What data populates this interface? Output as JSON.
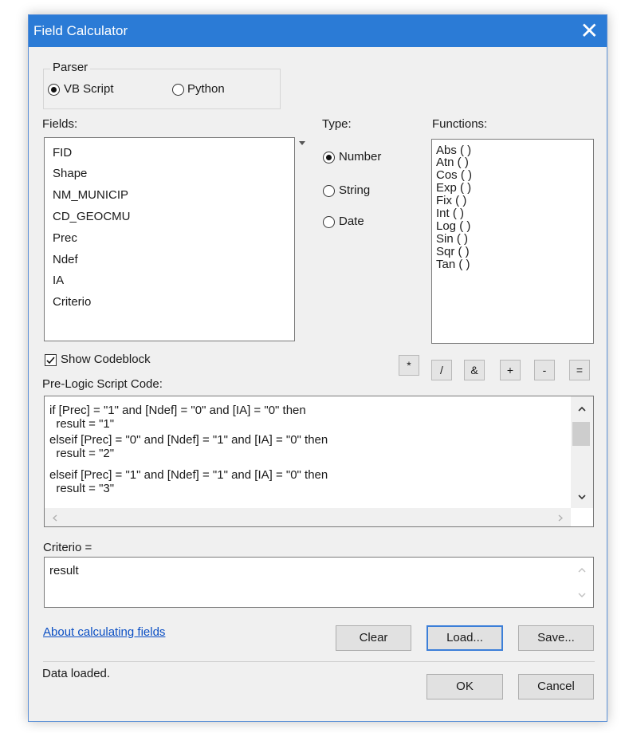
{
  "window": {
    "title": "Field Calculator",
    "close_glyph": "✕"
  },
  "parser": {
    "legend": "Parser",
    "options": [
      {
        "label": "VB Script",
        "selected": true
      },
      {
        "label": "Python",
        "selected": false
      }
    ]
  },
  "fields": {
    "label": "Fields:",
    "items": [
      "FID",
      "Shape",
      "NM_MUNICIP",
      "CD_GEOCMU",
      "Prec",
      "Ndef",
      "IA",
      "Criterio"
    ]
  },
  "type": {
    "label": "Type:",
    "options": [
      {
        "label": "Number",
        "selected": true
      },
      {
        "label": "String",
        "selected": false
      },
      {
        "label": "Date",
        "selected": false
      }
    ]
  },
  "functions": {
    "label": "Functions:",
    "items": [
      "Abs ( )",
      "Atn ( )",
      "Cos ( )",
      "Exp ( )",
      "Fix ( )",
      "Int ( )",
      "Log ( )",
      "Sin ( )",
      "Sqr ( )",
      "Tan ( )"
    ]
  },
  "show_codeblock": {
    "label": "Show Codeblock",
    "checked": true
  },
  "operators": [
    "*",
    "/",
    "&",
    "+",
    "-",
    "="
  ],
  "prelogic": {
    "label": "Pre-Logic Script Code:",
    "lines": [
      "if [Prec] = \"1\" and [Ndef] = \"0\" and [IA] = \"0\" then",
      "  result = \"1\"",
      "elseif [Prec] = \"0\" and [Ndef] = \"1\" and [IA] = \"0\" then",
      "  result = \"2\"",
      "elseif [Prec] = \"1\" and [Ndef] = \"1\" and [IA] = \"0\" then",
      "  result = \"3\""
    ]
  },
  "expression": {
    "label": "Criterio =",
    "value": "result"
  },
  "about_link": "About calculating fields",
  "buttons": {
    "clear": "Clear",
    "load": "Load...",
    "save": "Save...",
    "ok": "OK",
    "cancel": "Cancel"
  },
  "status": "Data loaded.",
  "colors": {
    "titlebar": "#2b7bd6",
    "link": "#0b4fc4",
    "focus": "#3c7fd8"
  },
  "icons": {
    "close": "close-icon",
    "radio": "radio-icon",
    "checkbox": "checkmark-icon",
    "scroll_up": "chevron-up-icon",
    "scroll_down": "chevron-down-icon",
    "scroll_left": "chevron-left-icon",
    "scroll_right": "chevron-right-icon",
    "sort": "sort-arrow-icon"
  }
}
